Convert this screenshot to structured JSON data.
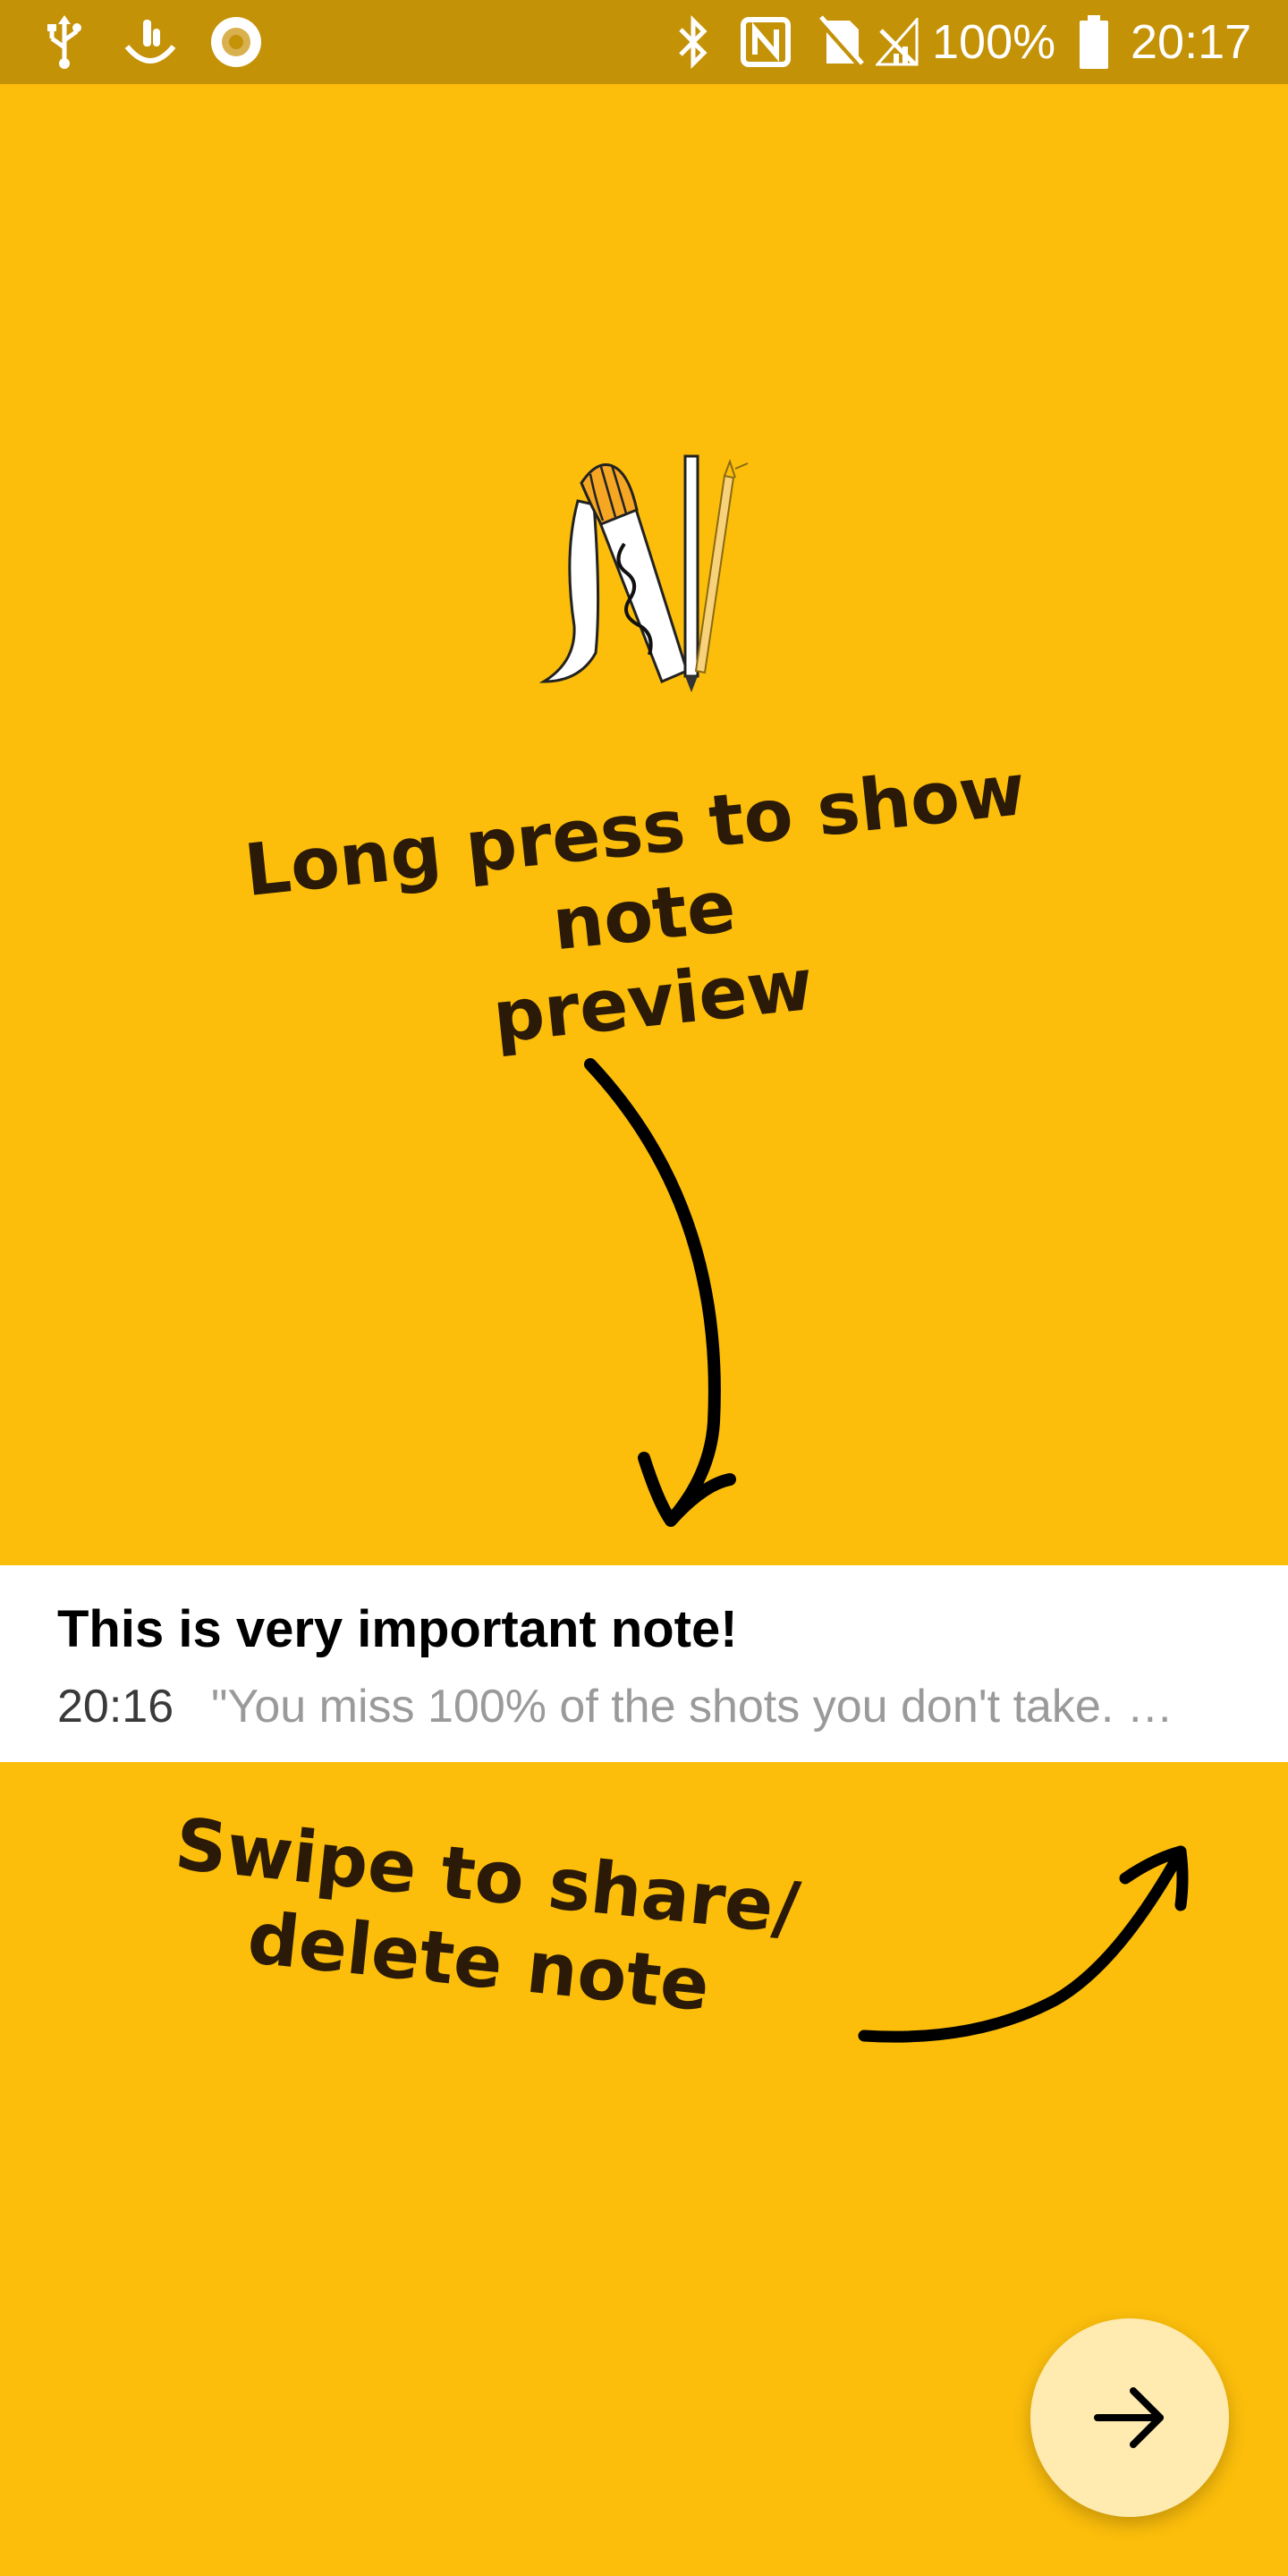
{
  "status_bar": {
    "battery_text": "100%",
    "time": "20:17",
    "icons": [
      "usb-icon",
      "touch-icon",
      "record-icon",
      "bluetooth-icon",
      "nfc-icon",
      "no-sim-icon",
      "signal-icon",
      "battery-icon"
    ]
  },
  "onboarding": {
    "hint_top_line1": "Long press to show note",
    "hint_top_line2": "preview",
    "hint_bottom_line1": "Swipe to share/",
    "hint_bottom_line2": "delete note"
  },
  "note": {
    "title": "This is very important note!",
    "time": "20:16",
    "preview": "\"You miss 100% of the shots you don't take. …"
  },
  "fab": {
    "icon": "arrow-right-icon"
  },
  "colors": {
    "background": "#FCBE0B",
    "status_bar": "#C49207",
    "hint_text": "#2A1A07",
    "fab": "#FFEBB0"
  }
}
